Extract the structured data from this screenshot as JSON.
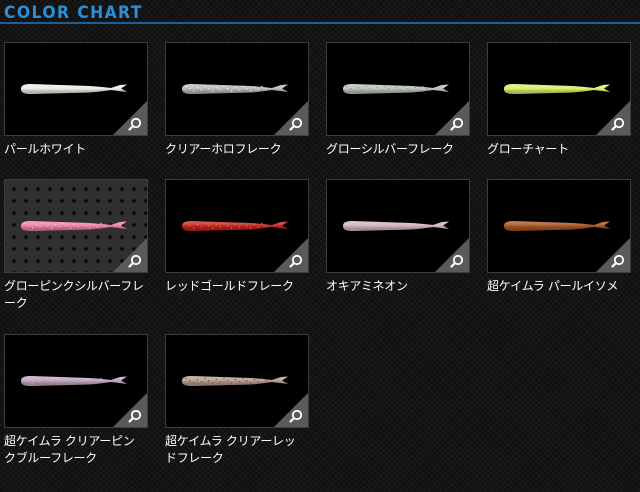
{
  "header": {
    "title": "COLOR CHART"
  },
  "items": [
    {
      "label": "パールホワイト",
      "color": "#e6ece3",
      "flake": "",
      "pegboard": false
    },
    {
      "label": "クリアーホロフレーク",
      "color": "#b8b8b8",
      "flake": "#efefef",
      "pegboard": false
    },
    {
      "label": "グローシルバーフレーク",
      "color": "#b9c4b6",
      "flake": "#8c9a8a",
      "pegboard": false
    },
    {
      "label": "グローチャート",
      "color": "#d8ef68",
      "flake": "",
      "pegboard": false
    },
    {
      "label": "グローピンクシルバーフレーク",
      "color": "#ee7fa9",
      "flake": "#f6b9cf",
      "pegboard": true
    },
    {
      "label": "レッドゴールドフレーク",
      "color": "#c3241f",
      "flake": "#e9743e",
      "pegboard": false
    },
    {
      "label": "オキアミネオン",
      "color": "#d2b4bd",
      "flake": "",
      "pegboard": false
    },
    {
      "label": "超ケイムラ パールイソメ",
      "color": "#a65523",
      "flake": "",
      "pegboard": false
    },
    {
      "label": "超ケイムラ クリアーピンクブルーフレーク",
      "color": "#c2a4bb",
      "flake": "#9db4d6",
      "pegboard": false
    },
    {
      "label": "超ケイムラ クリアーレッドフレーク",
      "color": "#b79b8f",
      "flake": "#7c4a3e",
      "pegboard": false
    }
  ]
}
